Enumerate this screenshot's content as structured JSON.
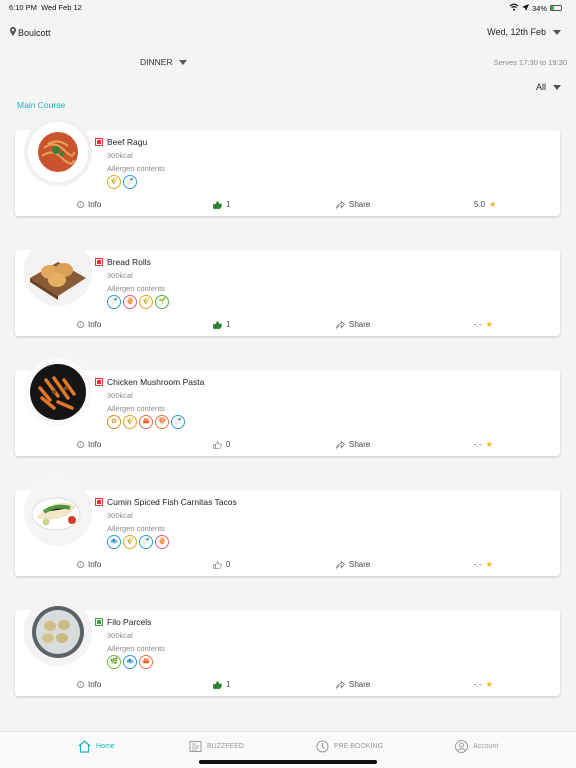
{
  "status_bar": {
    "time": "6:10 PM",
    "date": "Wed Feb 12",
    "battery": "34%",
    "battery_level": 0.34
  },
  "header": {
    "location": "Boulcott",
    "date_selector": "Wed, 12th Feb",
    "meal_selector": "DINNER",
    "serves": "Serves 17:30 to 19:30",
    "filter": "All"
  },
  "section_title": "Main Course",
  "colors": {
    "accent": "#17b3c0",
    "nonveg": "#e53935",
    "veg": "#43a047",
    "like_active": "#2e7d32",
    "star": "#f2b518"
  },
  "menu_items": [
    {
      "name": "Beef Ragu",
      "kcal": "300kcal",
      "allergen_label": "Allergen contents",
      "diet": "nonveg",
      "allergens": [
        {
          "icon": "wheat-icon",
          "glyph": "🌾",
          "color": "#e3a926"
        },
        {
          "icon": "milk-bottle-icon",
          "glyph": "🍼",
          "color": "#2a9fd6"
        }
      ],
      "info": "Info",
      "likes": "1",
      "liked": true,
      "share": "Share",
      "rating": "5.0"
    },
    {
      "name": "Bread Rolls",
      "kcal": "300kcal",
      "allergen_label": "Allergen contents",
      "diet": "nonveg",
      "allergens": [
        {
          "icon": "milk-bottle-icon",
          "glyph": "🍼",
          "color": "#2a9fd6"
        },
        {
          "icon": "egg-icon",
          "glyph": "🥚",
          "color": "#e0607e"
        },
        {
          "icon": "wheat-icon",
          "glyph": "🌾",
          "color": "#e3a926"
        },
        {
          "icon": "soy-icon",
          "glyph": "🌱",
          "color": "#4caf50"
        }
      ],
      "info": "Info",
      "likes": "1",
      "liked": true,
      "share": "Share",
      "rating": "-.-"
    },
    {
      "name": "Chicken Mushroom Pasta",
      "kcal": "300kcal",
      "allergen_label": "Allergen contents",
      "diet": "nonveg",
      "allergens": [
        {
          "icon": "sesame-icon",
          "glyph": "✿",
          "color": "#e08a1e"
        },
        {
          "icon": "wheat-icon",
          "glyph": "🌾",
          "color": "#e3a926"
        },
        {
          "icon": "crustacean-icon",
          "glyph": "🦀",
          "color": "#e76f51"
        },
        {
          "icon": "mushroom-icon",
          "glyph": "🍄",
          "color": "#d97c42"
        },
        {
          "icon": "milk-bottle-icon",
          "glyph": "🍼",
          "color": "#2a9fd6"
        }
      ],
      "info": "Info",
      "likes": "0",
      "liked": false,
      "share": "Share",
      "rating": "-.-"
    },
    {
      "name": "Cumin Spiced Fish Carnitas Tacos",
      "kcal": "300kcal",
      "allergen_label": "Allergen contents",
      "diet": "nonveg",
      "allergens": [
        {
          "icon": "fish-icon",
          "glyph": "🐟",
          "color": "#2a9fd6"
        },
        {
          "icon": "wheat-icon",
          "glyph": "🌾",
          "color": "#e3a926"
        },
        {
          "icon": "milk-bottle-icon",
          "glyph": "🍼",
          "color": "#2a9fd6"
        },
        {
          "icon": "egg-icon",
          "glyph": "🥚",
          "color": "#e0607e"
        }
      ],
      "info": "Info",
      "likes": "0",
      "liked": false,
      "share": "Share",
      "rating": "-.-"
    },
    {
      "name": "Filo Parcels",
      "kcal": "300kcal",
      "allergen_label": "Allergen contents",
      "diet": "veg",
      "allergens": [
        {
          "icon": "celery-icon",
          "glyph": "🌿",
          "color": "#7cb342"
        },
        {
          "icon": "fish-icon",
          "glyph": "🐟",
          "color": "#2a9fd6"
        },
        {
          "icon": "crustacean-icon",
          "glyph": "🦀",
          "color": "#e76f51"
        }
      ],
      "info": "Info",
      "likes": "1",
      "liked": true,
      "share": "Share",
      "rating": "-.-"
    }
  ],
  "tabbar": [
    {
      "label": "Home",
      "icon": "home-icon",
      "active": true
    },
    {
      "label": "BUZZFEED",
      "icon": "newspaper-icon",
      "active": false
    },
    {
      "label": "PRE BOOKING",
      "icon": "clock-icon",
      "active": false
    },
    {
      "label": "Account",
      "icon": "account-icon",
      "active": false
    }
  ]
}
